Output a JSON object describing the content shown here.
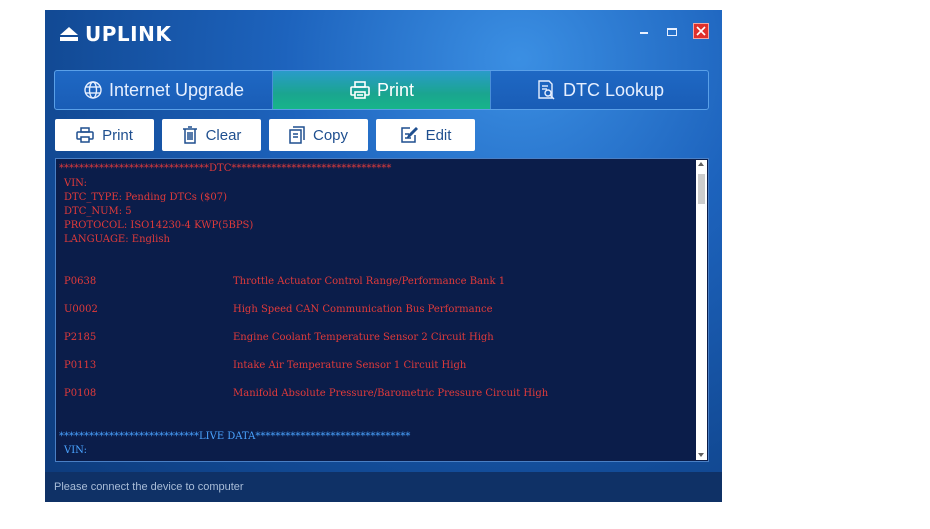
{
  "app": {
    "name": "UPLINK"
  },
  "tabs": [
    {
      "label": "Internet Upgrade",
      "icon": "globe-icon",
      "active": false
    },
    {
      "label": "Print",
      "icon": "printer-icon",
      "active": true
    },
    {
      "label": "DTC Lookup",
      "icon": "document-search-icon",
      "active": false
    }
  ],
  "toolbar": {
    "print_label": "Print",
    "clear_label": "Clear",
    "copy_label": "Copy",
    "edit_label": "Edit"
  },
  "console": {
    "dtc_header": "******************************DTC********************************",
    "vin": "VIN:",
    "dtc_type": "DTC_TYPE: Pending DTCs ($07)",
    "dtc_num": "DTC_NUM: 5",
    "protocol": "PROTOCOL: ISO14230-4 KWP(5BPS)",
    "language": "LANGUAGE: English",
    "codes": [
      {
        "code": "P0638",
        "description": "Throttle Actuator Control Range/Performance Bank 1"
      },
      {
        "code": "U0002",
        "description": "High Speed CAN Communication Bus Performance"
      },
      {
        "code": "P2185",
        "description": "Engine Coolant Temperature Sensor 2 Circuit High"
      },
      {
        "code": "P0113",
        "description": "Intake Air Temperature Sensor 1 Circuit High"
      },
      {
        "code": "P0108",
        "description": "Manifold Absolute Pressure/Barometric Pressure Circuit High"
      }
    ],
    "live_header": "****************************LIVE DATA*******************************",
    "live_vin": "VIN:"
  },
  "status": {
    "text": "Please connect the device to computer"
  },
  "colors": {
    "console_bg": "#0b1d4a",
    "dtc_text": "#e13a3a",
    "live_text": "#4aa3ff",
    "active_tab": "#17b48a",
    "close_button": "#e0302b"
  }
}
